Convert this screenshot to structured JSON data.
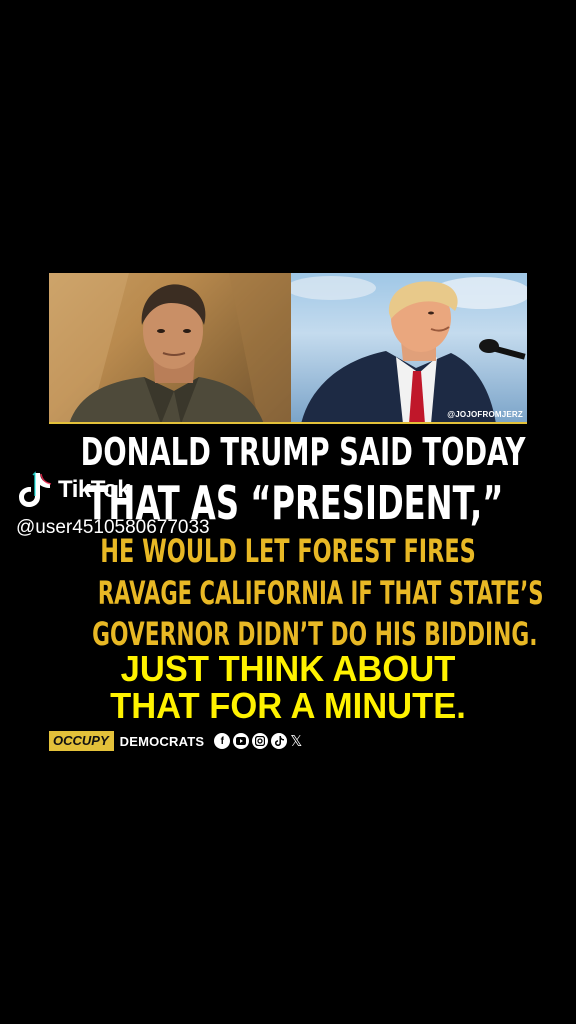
{
  "photo": {
    "watermark": "@JOJOFROMJERZ"
  },
  "headline": {
    "line1": "DONALD TRUMP SAID TODAY",
    "line2": "THAT AS “PRESIDENT,”",
    "line3": "HE WOULD LET FOREST FIRES",
    "line4": "RAVAGE CALIFORNIA IF THAT STATE’S",
    "line5": "GOVERNOR DIDN’T DO HIS BIDDING.",
    "line6": "JUST THINK ABOUT",
    "line7": "THAT FOR A MINUTE."
  },
  "tiktok": {
    "logo_text": "TikTok",
    "username": "@user4510580677033"
  },
  "brand": {
    "occupy": "OCCUPY",
    "democrats": "DEMOCRATS",
    "social_icons": [
      "facebook-icon",
      "youtube-icon",
      "instagram-icon",
      "tiktok-icon",
      "x-icon"
    ]
  },
  "colors": {
    "background": "#000000",
    "headline_white": "#ffffff",
    "headline_gold": "#e8b825",
    "headline_yellow": "#fff200",
    "brand_gold": "#e3c13a"
  }
}
